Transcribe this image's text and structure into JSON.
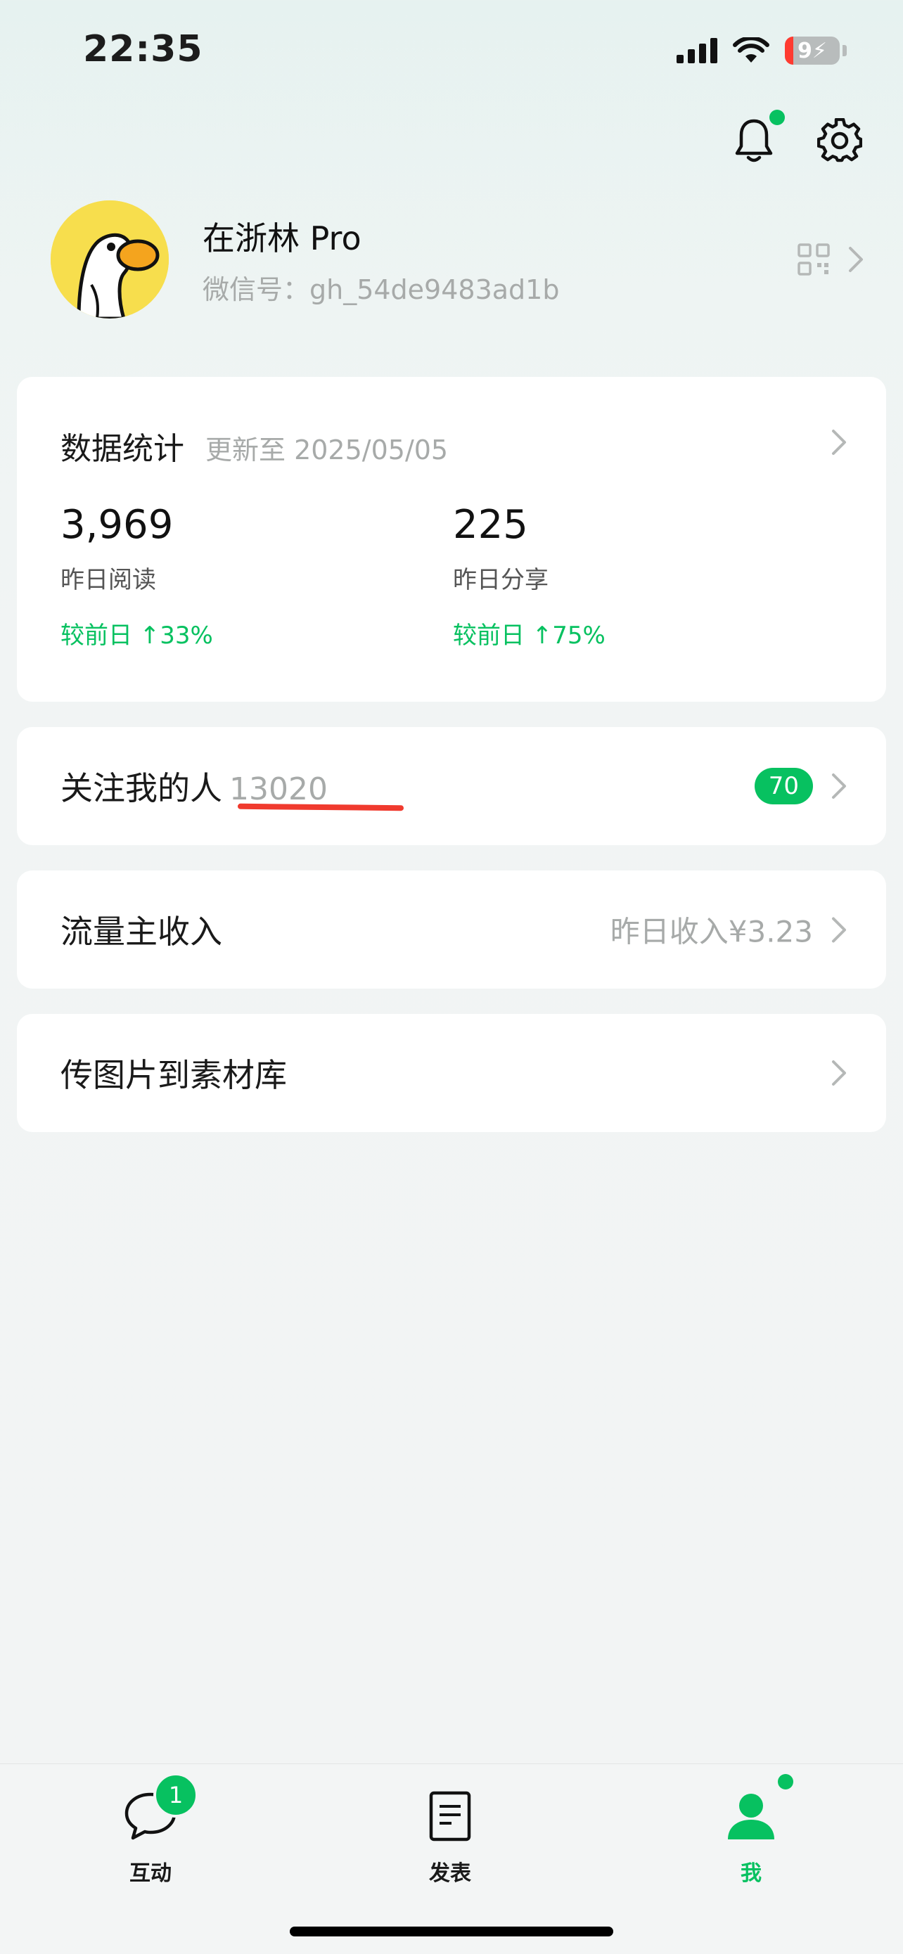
{
  "status_bar": {
    "time": "22:35",
    "battery": "9"
  },
  "profile": {
    "name": "在浙林 Pro",
    "wechat_id": "微信号：gh_54de9483ad1b"
  },
  "stats": {
    "title": "数据统计",
    "updated": "更新至 2025/05/05",
    "items": [
      {
        "value": "3,969",
        "label": "昨日阅读",
        "change": "较前日 ↑33%"
      },
      {
        "value": "225",
        "label": "昨日分享",
        "change": "较前日 ↑75%"
      }
    ]
  },
  "followers": {
    "label": "关注我的人",
    "count": "13020",
    "badge": "70"
  },
  "income": {
    "label": "流量主收入",
    "hint": "昨日收入¥3.23"
  },
  "upload": {
    "label": "传图片到素材库"
  },
  "tabbar": {
    "tabs": [
      {
        "label": "互动",
        "badge": "1",
        "icon": "chat-bubble-icon"
      },
      {
        "label": "发表",
        "icon": "document-icon"
      },
      {
        "label": "我",
        "icon": "person-icon"
      }
    ],
    "active_color": "#07c160"
  },
  "colors": {
    "accent": "#07c160",
    "annotation": "#f03a2e"
  }
}
